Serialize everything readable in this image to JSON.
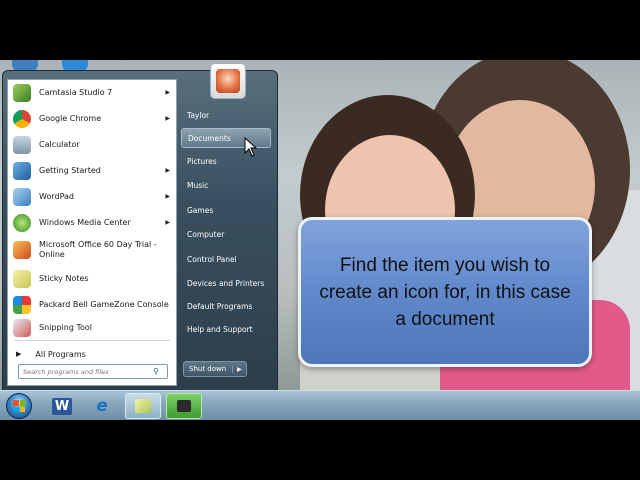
{
  "start_menu": {
    "programs": [
      {
        "label": "Camtasia Studio 7",
        "icon": "camtasia-icon",
        "has_submenu": true
      },
      {
        "label": "Google Chrome",
        "icon": "chrome-icon",
        "has_submenu": true
      },
      {
        "label": "Calculator",
        "icon": "calculator-icon",
        "has_submenu": false
      },
      {
        "label": "Getting Started",
        "icon": "getting-started-icon",
        "has_submenu": true
      },
      {
        "label": "WordPad",
        "icon": "wordpad-icon",
        "has_submenu": true
      },
      {
        "label": "Windows Media Center",
        "icon": "media-center-icon",
        "has_submenu": true
      },
      {
        "label": "Microsoft Office 60 Day Trial - Online",
        "icon": "office-icon",
        "has_submenu": false
      },
      {
        "label": "Sticky Notes",
        "icon": "sticky-notes-icon",
        "has_submenu": false
      },
      {
        "label": "Packard Bell GameZone Console",
        "icon": "gamezone-icon",
        "has_submenu": false
      },
      {
        "label": "Snipping Tool",
        "icon": "snipping-tool-icon",
        "has_submenu": false
      }
    ],
    "all_programs": "All Programs",
    "search_placeholder": "Search programs and files",
    "right_items": [
      {
        "label": "Taylor"
      },
      {
        "label": "Documents",
        "highlighted": true
      },
      {
        "label": "Pictures"
      },
      {
        "label": "Music"
      },
      {
        "label": "Games"
      },
      {
        "label": "Computer"
      },
      {
        "label": "Control Panel"
      },
      {
        "label": "Devices and Printers"
      },
      {
        "label": "Default Programs"
      },
      {
        "label": "Help and Support"
      }
    ],
    "shutdown_label": "Shut down"
  },
  "callout": {
    "text": "Find the item you wish to create an icon for, in this case a document"
  },
  "taskbar": {
    "items": [
      {
        "icon": "word-icon",
        "glyph": "W"
      },
      {
        "icon": "internet-explorer-icon",
        "glyph": "e"
      },
      {
        "icon": "sticky-notes-icon",
        "glyph": ""
      },
      {
        "icon": "camtasia-recorder-icon",
        "glyph": ""
      }
    ]
  },
  "colors": {
    "callout_fill": "#6a8fd0",
    "menu_dark": "#2c3e4c",
    "taskbar": "#86a5bb"
  }
}
